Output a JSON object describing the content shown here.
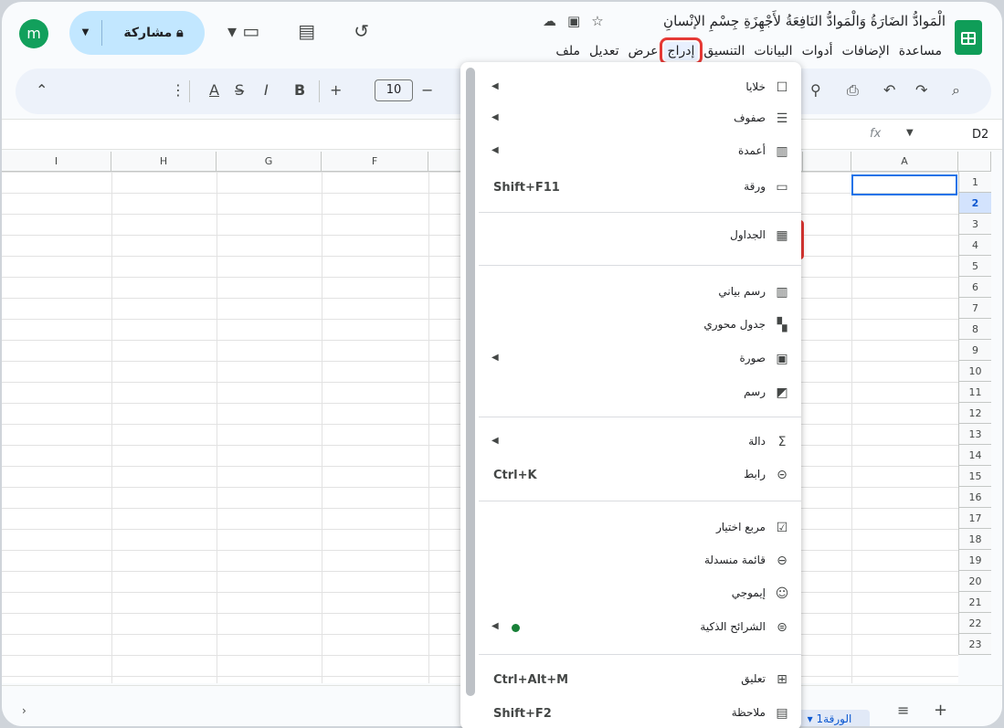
{
  "document": {
    "title": "الْمَوادُّ الضَارَةُ وَالْمَوادُّ النَافِعَةُ لأَجْهِزَةِ جِسْمِ الإنْسانِ",
    "user_initial": "m",
    "share_label": "مشاركة"
  },
  "menubar": [
    "ملف",
    "تعديل",
    "عرض",
    "إدراج",
    "التنسيق",
    "البيانات",
    "أدوات",
    "الإضافات",
    "مساعدة"
  ],
  "menubar_highlighted": "إدراج",
  "toolbar": {
    "font_size": "10",
    "cell_ref": "D2",
    "fx_label": "fx"
  },
  "columns": [
    "I",
    "H",
    "G",
    "F",
    "",
    "",
    "",
    "",
    "A"
  ],
  "rows": [
    "1",
    "2",
    "3",
    "4",
    "5",
    "6",
    "7",
    "8",
    "9",
    "10",
    "11",
    "12",
    "13",
    "14",
    "15",
    "16",
    "17",
    "18",
    "19",
    "20",
    "21",
    "22",
    "23"
  ],
  "selected_row": "2",
  "sheet_tab": "الورقة1",
  "insert_menu": {
    "items": [
      {
        "label": "خلايا",
        "icon": "cells-icon",
        "submenu": true
      },
      {
        "label": "صفوف",
        "icon": "rows-icon",
        "submenu": true
      },
      {
        "label": "أعمدة",
        "icon": "columns-icon",
        "submenu": true
      },
      {
        "label": "ورقة",
        "icon": "sheet-icon",
        "shortcut": "Shift+F11"
      },
      {
        "label": "الجداول",
        "icon": "table-icon",
        "highlighted": true
      },
      {
        "label": "رسم بياني",
        "icon": "chart-icon"
      },
      {
        "label": "جدول محوري",
        "icon": "pivot-table-icon"
      },
      {
        "label": "صورة",
        "icon": "image-icon",
        "submenu": true
      },
      {
        "label": "رسم",
        "icon": "drawing-icon"
      },
      {
        "label": "دالة",
        "icon": "sigma-icon",
        "submenu": true
      },
      {
        "label": "رابط",
        "icon": "link-icon",
        "shortcut": "Ctrl+K"
      },
      {
        "label": "مربع اختيار",
        "icon": "checkbox-icon"
      },
      {
        "label": "قائمة منسدلة",
        "icon": "dropdown-icon"
      },
      {
        "label": "إيموجي",
        "icon": "emoji-icon"
      },
      {
        "label": "الشرائح الذكية",
        "icon": "smart-chips-icon",
        "submenu": true,
        "new_dot": true
      },
      {
        "label": "تعليق",
        "icon": "comment-icon",
        "shortcut": "Ctrl+Alt+M"
      },
      {
        "label": "ملاحظة",
        "icon": "note-icon",
        "shortcut": "Shift+F2"
      }
    ]
  },
  "colors": {
    "accent": "#0b57d0",
    "highlight_red": "#e53935",
    "sheets_green": "#0f9d58"
  }
}
